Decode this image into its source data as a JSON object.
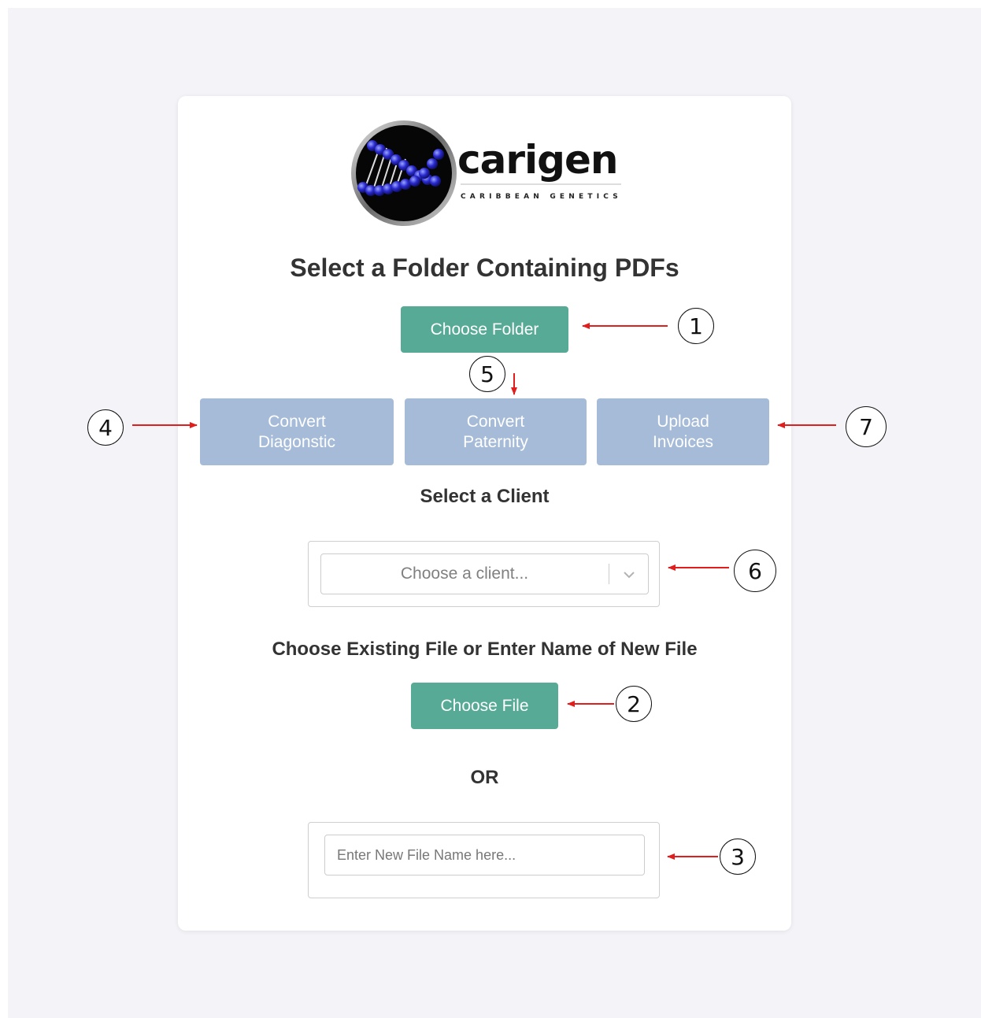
{
  "brand": {
    "name": "carigen",
    "tagline": "CARIBBEAN GENETICS"
  },
  "header": {
    "title": "Select a Folder Containing PDFs"
  },
  "actions": {
    "choose_folder": "Choose Folder",
    "convert_diagnostic": [
      "Convert",
      "Diagonstic"
    ],
    "convert_paternity": [
      "Convert",
      "Paternity"
    ],
    "upload_invoices": [
      "Upload",
      "Invoices"
    ]
  },
  "client": {
    "heading": "Select a Client",
    "select_placeholder": "Choose a client..."
  },
  "file": {
    "heading": "Choose Existing File or Enter Name of New File",
    "choose_file": "Choose File",
    "or_label": "OR",
    "new_file_placeholder": "Enter New File Name here..."
  },
  "annotations": [
    "1",
    "2",
    "3",
    "4",
    "5",
    "6",
    "7"
  ],
  "colors": {
    "primary_button": "#57aa96",
    "disabled_button": "#a5bbd8",
    "page_background": "#f3f3f8",
    "annotation_arrow": "#e01e1e"
  }
}
